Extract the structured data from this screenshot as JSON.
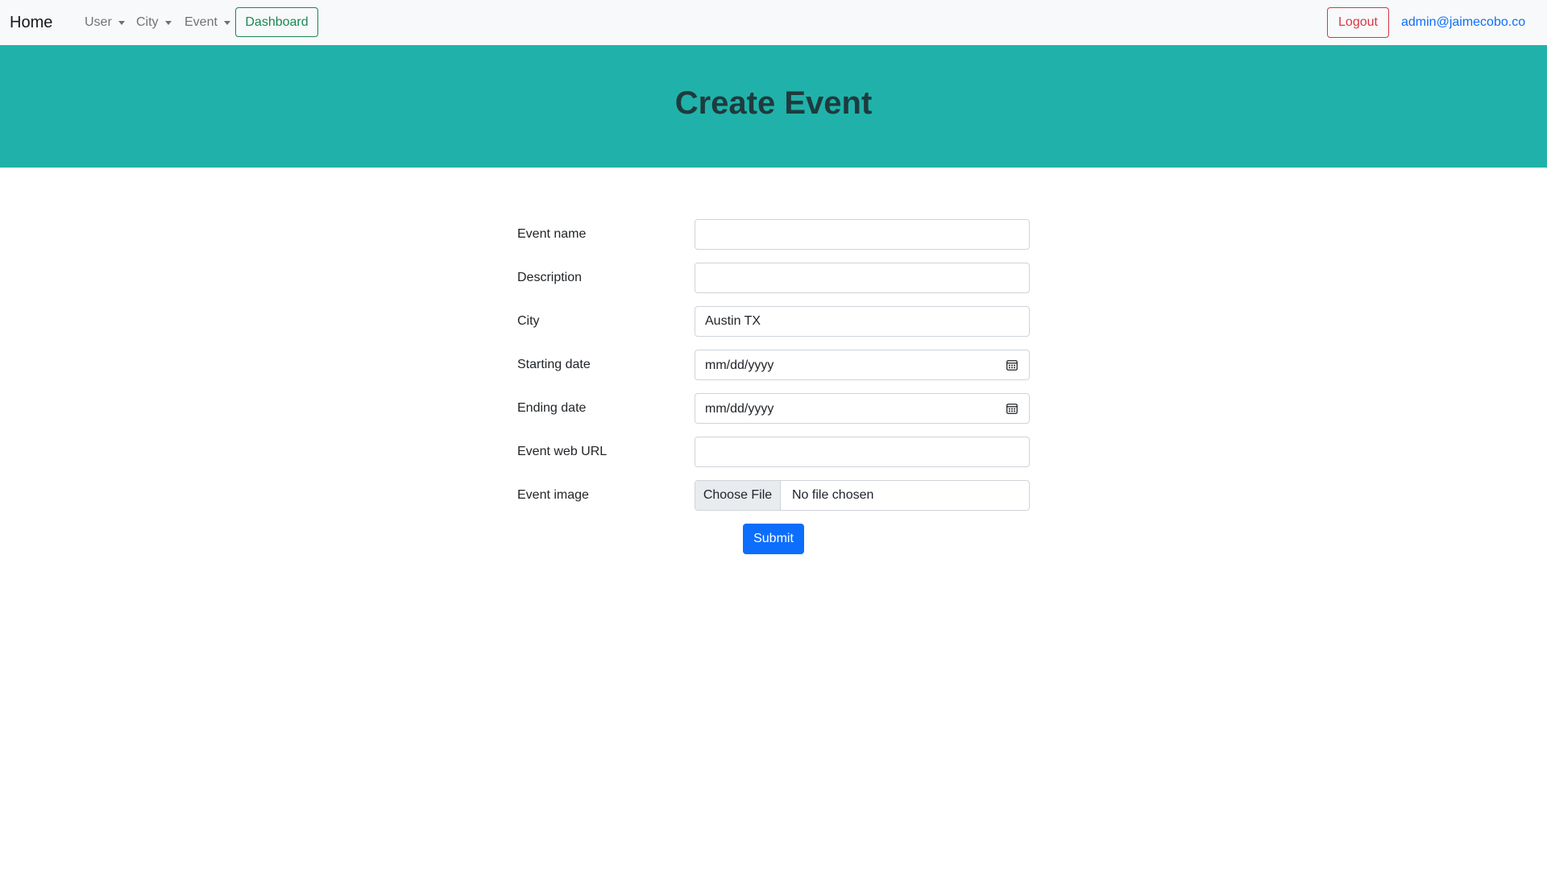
{
  "navbar": {
    "brand": "Home",
    "menus": [
      {
        "label": "User"
      },
      {
        "label": "City"
      },
      {
        "label": "Event"
      }
    ],
    "dashboard_label": "Dashboard",
    "logout_label": "Logout",
    "user_email": "admin@jaimecobo.co"
  },
  "header": {
    "title": "Create Event"
  },
  "form": {
    "fields": {
      "event_name": {
        "label": "Event name",
        "value": ""
      },
      "description": {
        "label": "Description",
        "value": ""
      },
      "city": {
        "label": "City",
        "value": "Austin TX"
      },
      "starting_date": {
        "label": "Starting date",
        "value": "mm/dd/yyyy"
      },
      "ending_date": {
        "label": "Ending date",
        "value": "mm/dd/yyyy"
      },
      "event_url": {
        "label": "Event web URL",
        "value": ""
      },
      "event_image": {
        "label": "Event image",
        "button": "Choose File",
        "status": "No file chosen"
      }
    },
    "submit_label": "Submit"
  },
  "colors": {
    "hero_bg": "#20b2aa",
    "primary": "#0d6efd",
    "success": "#198754",
    "danger": "#dc3545"
  },
  "icons": {
    "calendar": "calendar-icon",
    "dropdown": "caret-down-icon"
  }
}
